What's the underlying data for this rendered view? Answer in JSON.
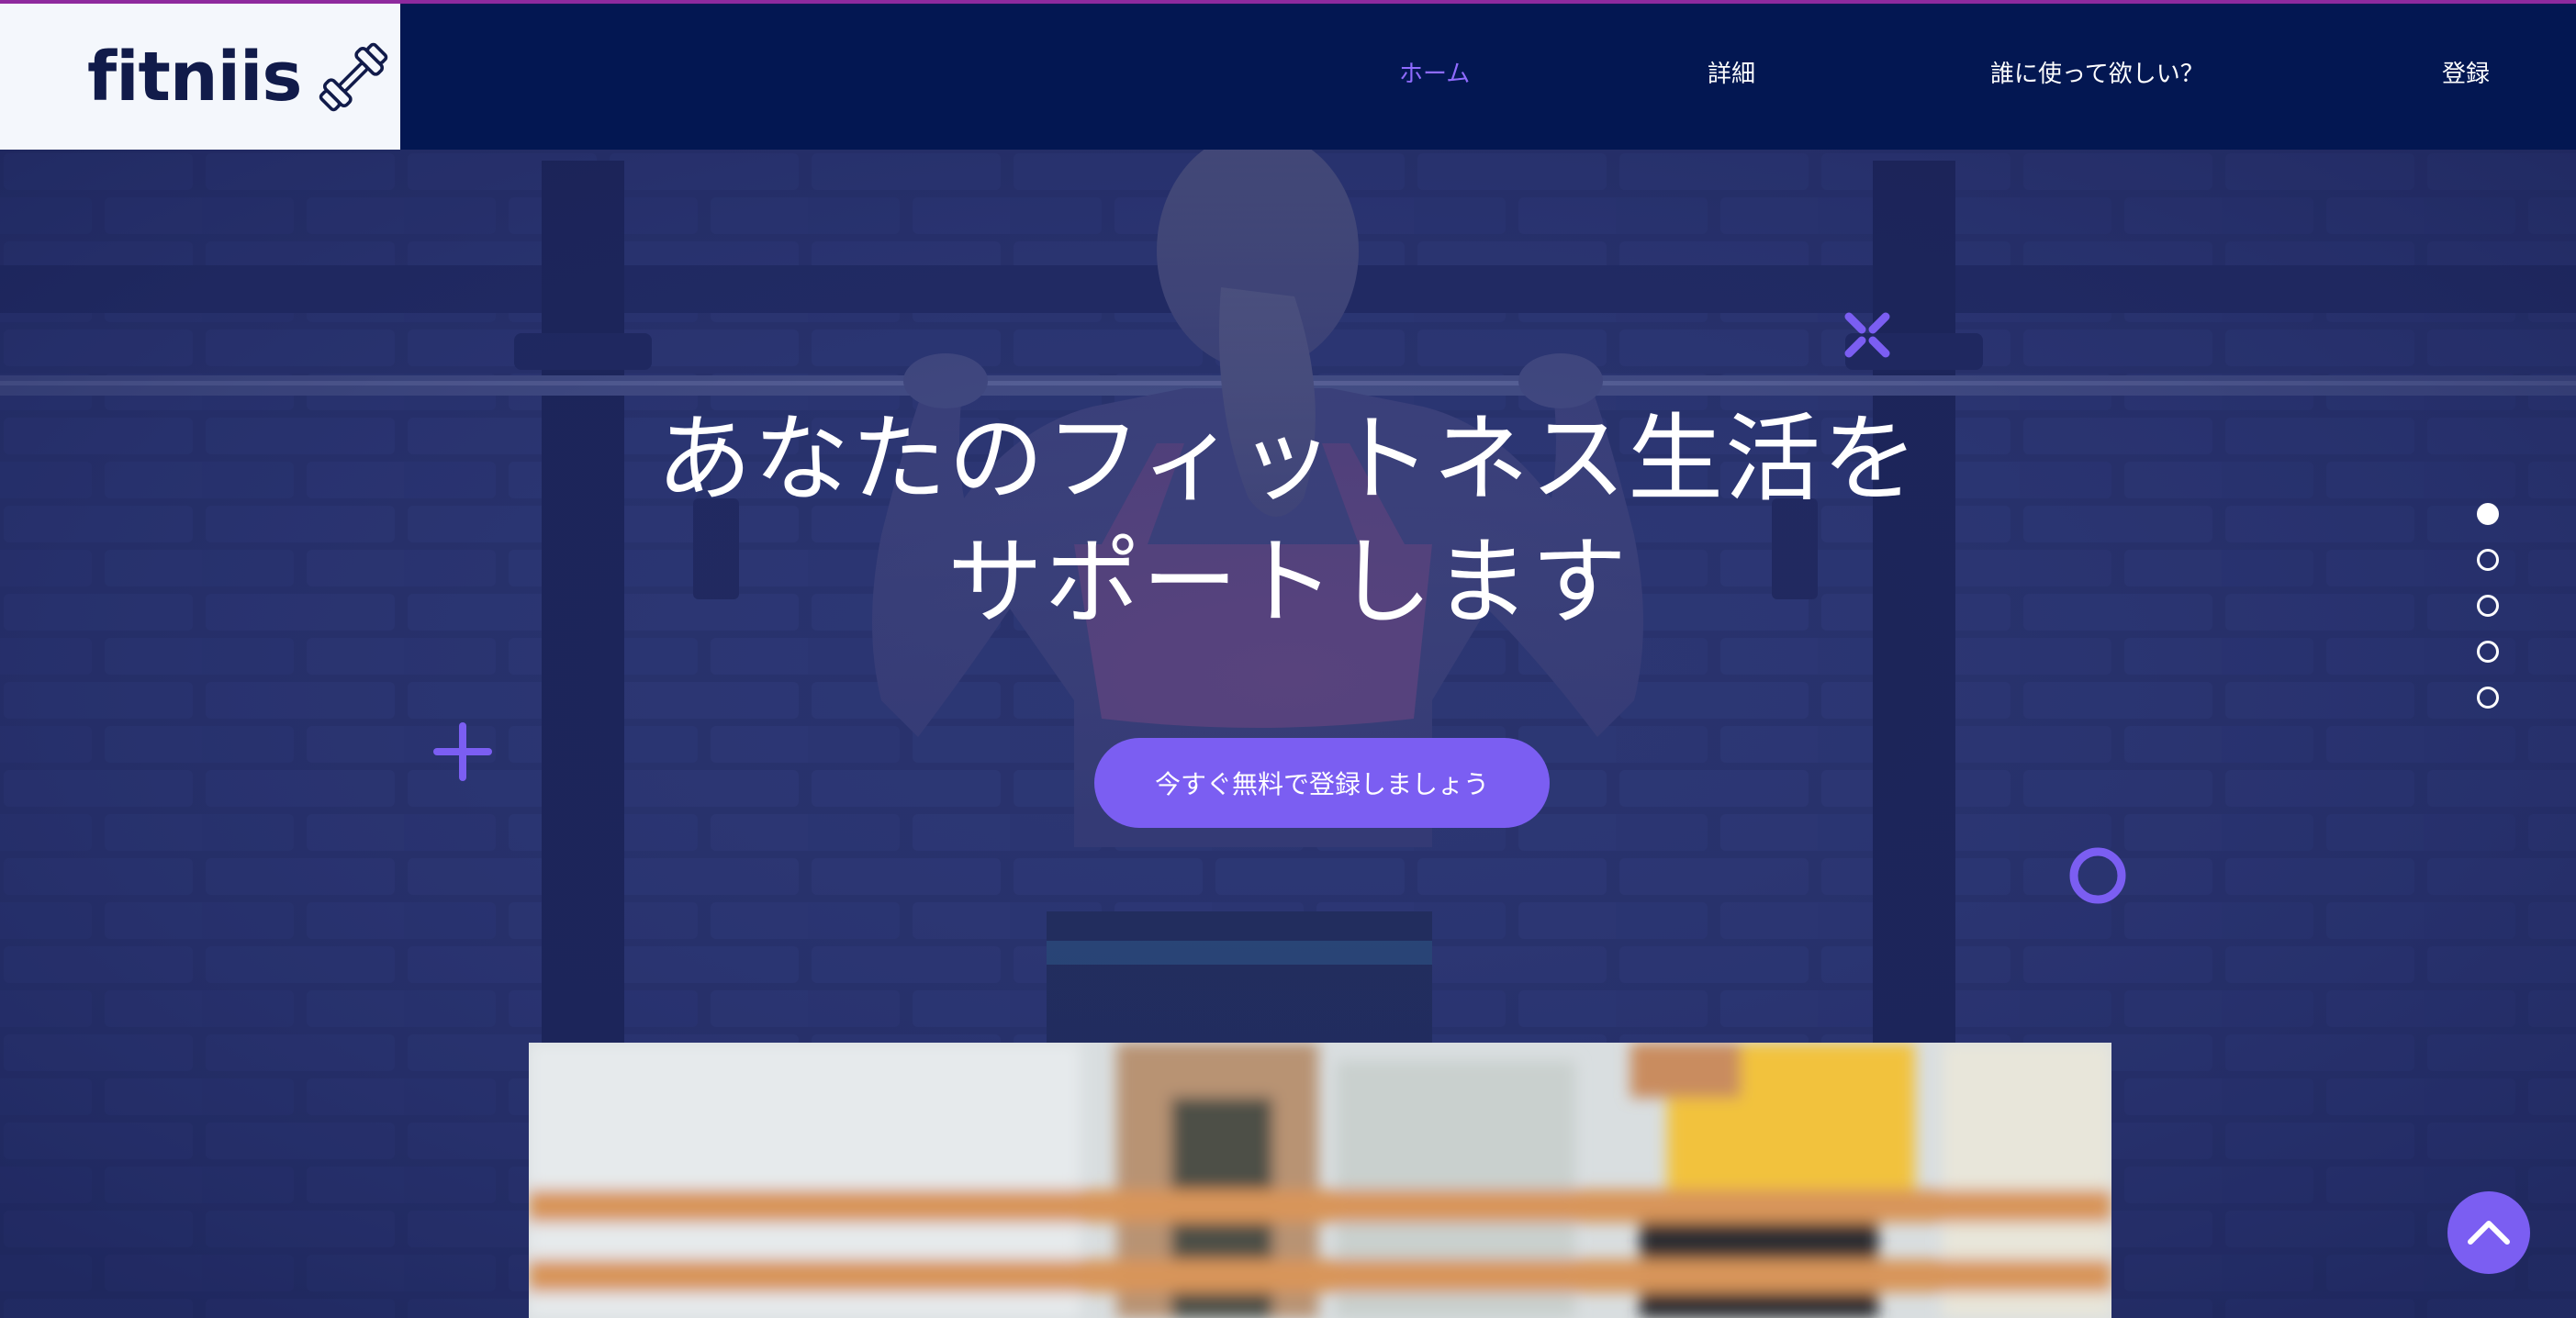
{
  "brand": {
    "name": "fitniis",
    "icon": "dumbbell-icon"
  },
  "nav": {
    "items": [
      {
        "label": "ホーム",
        "active": true
      },
      {
        "label": "詳細",
        "active": false
      },
      {
        "label": "誰に使って欲しい？",
        "active": false
      },
      {
        "label": "登録",
        "active": false
      }
    ]
  },
  "hero": {
    "title_line1": "あなたのフィットネス生活を",
    "title_line2": "サポートします",
    "cta_label": "今すぐ無料で登録しましょう"
  },
  "slider": {
    "count": 5,
    "active_index": 0
  },
  "colors": {
    "header_bg": "#031752",
    "accent": "#7b5ef2",
    "nav_active": "#8f6bff",
    "top_line": "#8e2a9e",
    "hero_overlay": "#27337a"
  },
  "icons": {
    "back_to_top": "chevron-up-icon",
    "decor_cross": "x-cross-icon",
    "decor_plus": "plus-icon",
    "decor_ring": "ring-icon"
  }
}
